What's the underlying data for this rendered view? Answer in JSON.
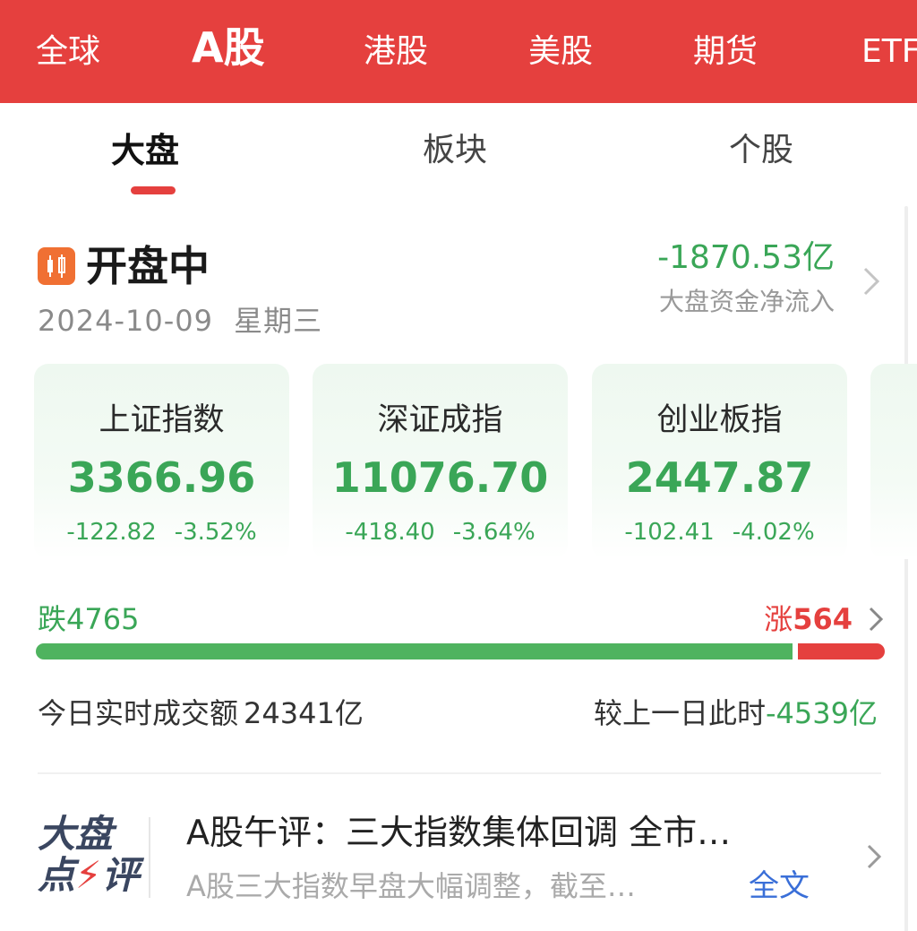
{
  "market_tabs": [
    {
      "label": "全球",
      "active": false
    },
    {
      "label": "A股",
      "active": true
    },
    {
      "label": "港股",
      "active": false
    },
    {
      "label": "美股",
      "active": false
    },
    {
      "label": "期货",
      "active": false
    },
    {
      "label": "ETF",
      "active": false
    }
  ],
  "sub_tabs": [
    {
      "label": "大盘",
      "active": true
    },
    {
      "label": "板块",
      "active": false
    },
    {
      "label": "个股",
      "active": false
    }
  ],
  "status": {
    "title": "开盘中",
    "date": "2024-10-09",
    "weekday": "星期三",
    "net_flow_value": "-1870.53亿",
    "net_flow_label": "大盘资金净流入"
  },
  "indices": [
    {
      "name": "上证指数",
      "value": "3366.96",
      "change": "-122.82",
      "pct": "-3.52%"
    },
    {
      "name": "深证成指",
      "value": "11076.70",
      "change": "-418.40",
      "pct": "-3.64%"
    },
    {
      "name": "创业板指",
      "value": "2447.87",
      "change": "-102.41",
      "pct": "-4.02%"
    }
  ],
  "breadth": {
    "fall_label": "跌",
    "fall_count": "4765",
    "rise_label": "涨",
    "rise_count": "564",
    "fall_ratio": 0.894
  },
  "turnover": {
    "label": "今日实时成交额",
    "value": "24341亿",
    "compare_label": "较上一日此时",
    "compare_value": "-4539亿"
  },
  "news": {
    "logo_line1": "大盘",
    "logo_line2_a": "点",
    "logo_line2_b": "评",
    "title": "A股午评：三大指数集体回调 全市…",
    "summary": "A股三大指数早盘大幅调整，截至…",
    "full_link": "全文"
  },
  "colors": {
    "brand_red": "#e5403e",
    "down_green": "#3aa657",
    "link_blue": "#3a6fd8"
  },
  "icons": {
    "status": "candlestick-icon",
    "chevron": "chevron-right-icon"
  }
}
